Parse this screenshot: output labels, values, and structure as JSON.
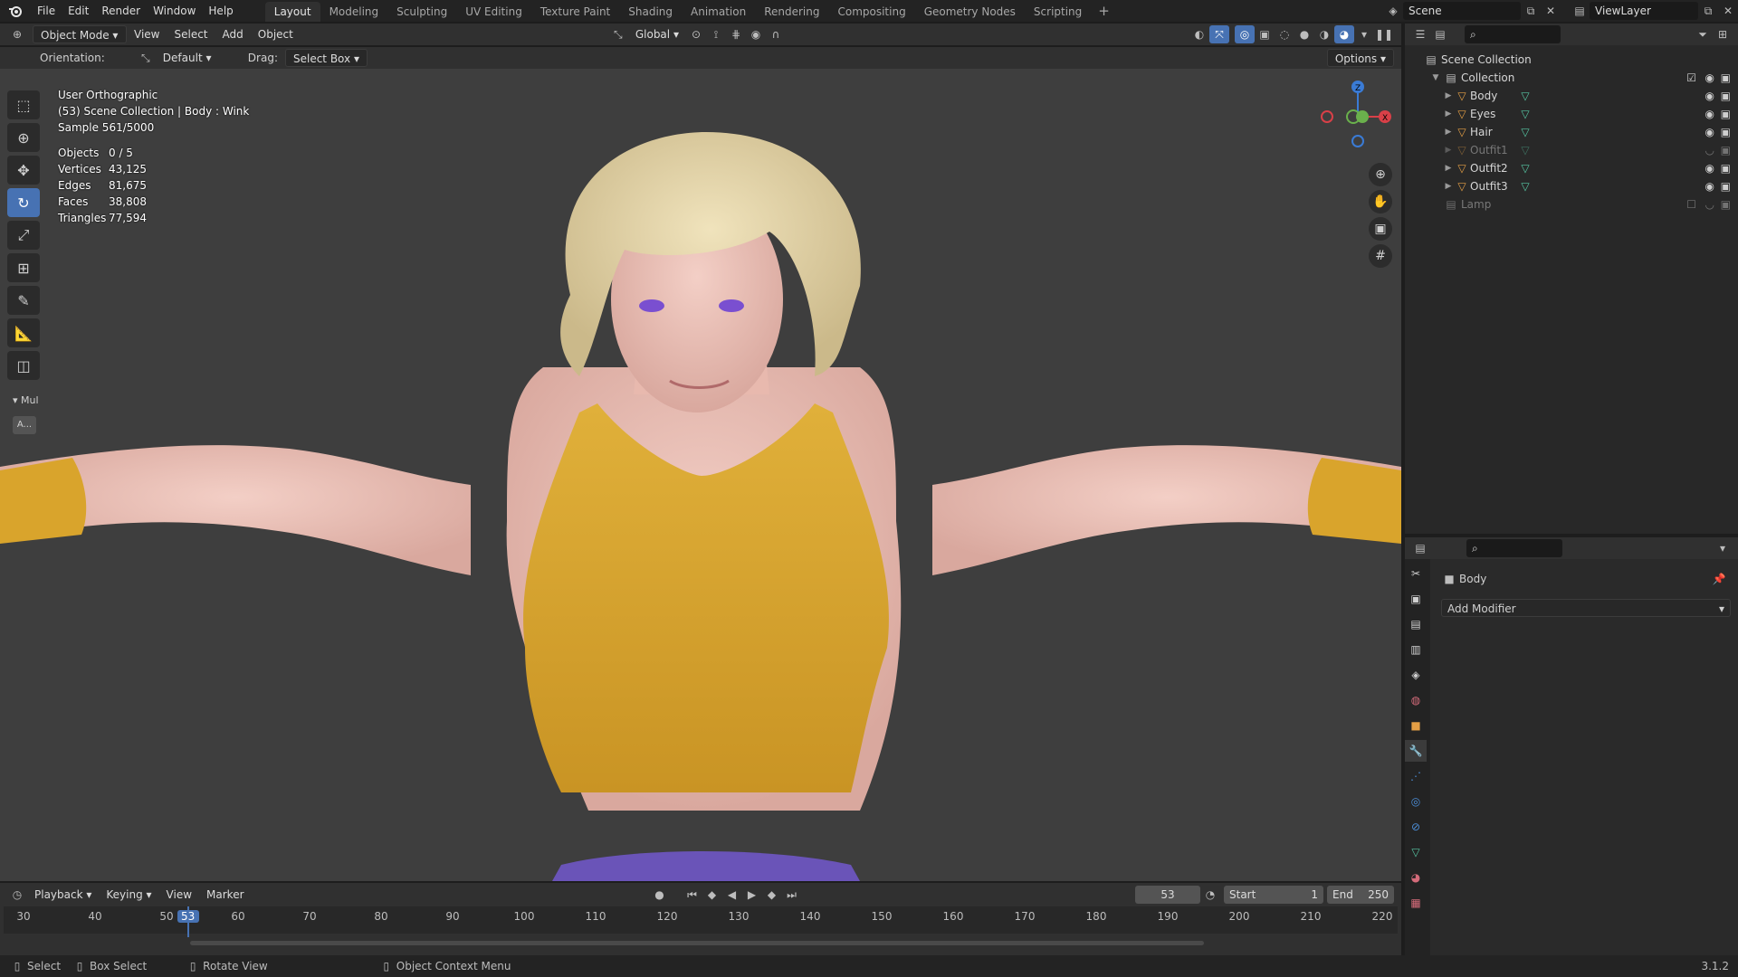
{
  "app": {
    "logo": "blender-logo",
    "version": "3.1.2"
  },
  "menus": [
    "File",
    "Edit",
    "Render",
    "Window",
    "Help"
  ],
  "workspaces": [
    "Layout",
    "Modeling",
    "Sculpting",
    "UV Editing",
    "Texture Paint",
    "Shading",
    "Animation",
    "Rendering",
    "Compositing",
    "Geometry Nodes",
    "Scripting"
  ],
  "active_workspace": "Layout",
  "scene": {
    "name": "Scene",
    "view_layer": "ViewLayer"
  },
  "header": {
    "mode": "Object Mode",
    "menus": [
      "View",
      "Select",
      "Add",
      "Object"
    ],
    "transform": "Global"
  },
  "subheader": {
    "orientation_label": "Orientation:",
    "orientation_value": "Default",
    "drag_label": "Drag:",
    "drag_value": "Select Box",
    "options": "Options"
  },
  "overlay": {
    "view": "User Orthographic",
    "context": "(53) Scene Collection | Body : Wink",
    "sample": "Sample 561/5000",
    "stats": [
      {
        "k": "Objects",
        "v": "0 / 5"
      },
      {
        "k": "Vertices",
        "v": "43,125"
      },
      {
        "k": "Edges",
        "v": "81,675"
      },
      {
        "k": "Faces",
        "v": "38,808"
      },
      {
        "k": "Triangles",
        "v": "77,594"
      }
    ]
  },
  "toolbar": {
    "panel_label": "Mul",
    "panel_btn": "A..."
  },
  "timeline": {
    "menus": [
      "Playback",
      "Keying",
      "View",
      "Marker"
    ],
    "current": "53",
    "start_label": "Start",
    "start": "1",
    "end_label": "End",
    "end": "250",
    "ticks": [
      "30",
      "40",
      "50",
      "53",
      "60",
      "70",
      "80",
      "90",
      "100",
      "110",
      "120",
      "130",
      "140",
      "150",
      "160",
      "170",
      "180",
      "190",
      "200",
      "210",
      "220"
    ]
  },
  "status": {
    "select": "Select",
    "box_select": "Box Select",
    "rotate": "Rotate View",
    "context": "Object Context Menu"
  },
  "outliner": {
    "root": "Scene Collection",
    "collection": "Collection",
    "items": [
      {
        "name": "Body",
        "dim": false
      },
      {
        "name": "Eyes",
        "dim": false
      },
      {
        "name": "Hair",
        "dim": false
      },
      {
        "name": "Outfit1",
        "dim": true
      },
      {
        "name": "Outfit2",
        "dim": false
      },
      {
        "name": "Outfit3",
        "dim": false
      }
    ],
    "lamp": "Lamp"
  },
  "properties": {
    "object": "Body",
    "add_modifier": "Add Modifier"
  },
  "colors": {
    "accent": "#4772b3",
    "object": "#e39e45",
    "mesh": "#56c5a2",
    "viewport": "#3e3e3e",
    "top": "#d4a830"
  }
}
